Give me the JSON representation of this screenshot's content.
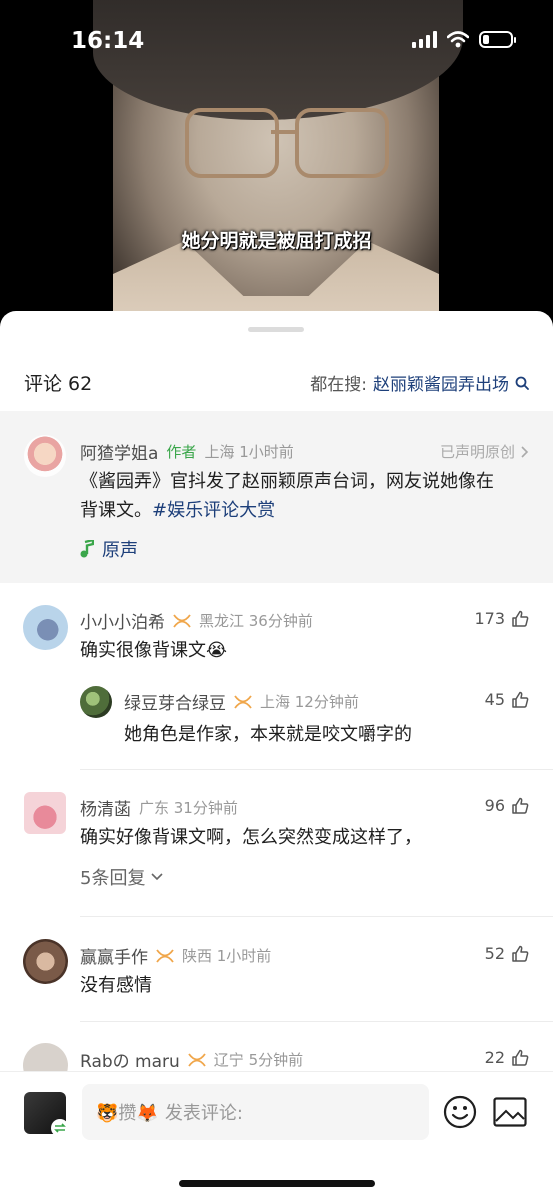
{
  "status_bar": {
    "time": "16:14"
  },
  "video": {
    "subtitle": "她分明就是被屈打成招"
  },
  "header": {
    "comment_count_label": "评论 62",
    "search_prefix": "都在搜:",
    "search_keyword": "赵丽颖酱园弄出场"
  },
  "pinned": {
    "username": "阿猹学姐a",
    "author_tag": "作者",
    "location_time": "上海 1小时前",
    "declared": "已声明原创",
    "text_line1": "《酱园弄》官抖发了赵丽颖原声台词，网友说她像在",
    "text_line2_plain": "背课文。",
    "hashtag": "#娱乐评论大赏",
    "original_sound": "原声"
  },
  "comments": [
    {
      "username": "小小小泊希",
      "location_time": "黑龙江 36分钟前",
      "likes": "173",
      "text": "确实很像背课文😭",
      "reply": {
        "username": "绿豆芽合绿豆",
        "location_time": "上海 12分钟前",
        "likes": "45",
        "text": "她角色是作家，本来就是咬文嚼字的"
      }
    },
    {
      "username": "杨清菡",
      "location_time": "广东 31分钟前",
      "likes": "96",
      "text": "确实好像背课文啊，怎么突然变成这样了，",
      "replies_label": "5条回复"
    },
    {
      "username": "赢赢手作",
      "location_time": "陕西 1小时前",
      "likes": "52",
      "text": "没有感情"
    },
    {
      "username": "Rabの maru",
      "location_time": "辽宁 5分钟前",
      "likes": "22"
    }
  ],
  "bottom_bar": {
    "input_prefix": "🐯攒🦊",
    "input_placeholder": "发表评论:"
  },
  "icons": [
    "signal-icon",
    "wifi-icon",
    "battery-icon",
    "search-icon",
    "chevron-right-icon",
    "music-note-icon",
    "vip-badge-icon",
    "thumbs-up-icon",
    "chevron-down-icon",
    "emoji-icon",
    "image-icon",
    "switch-icon"
  ],
  "colors": {
    "link": "#1d3f7a",
    "author": "#3aa64a",
    "vip": "#f0a64a"
  }
}
